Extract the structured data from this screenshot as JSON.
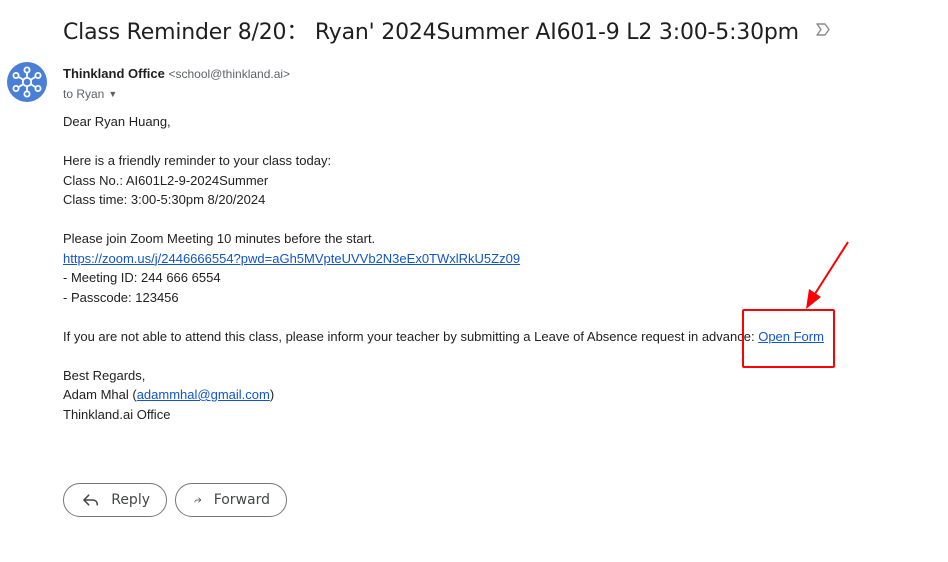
{
  "email": {
    "subject": "Class Reminder 8/20： Ryan' 2024Summer AI601-9 L2 3:00-5:30pm",
    "sender_name": "Thinkland Office",
    "sender_email": "<school@thinkland.ai>",
    "recipient": "to Ryan",
    "body": {
      "greeting": "Dear Ryan Huang,",
      "reminder": "Here is a friendly reminder to your class today:",
      "class_no": "Class No.: AI601L2-9-2024Summer",
      "class_time": "Class time: 3:00-5:30pm 8/20/2024",
      "join_note": "Please join Zoom Meeting 10 minutes before the start.",
      "zoom_link": "https://zoom.us/j/2446666554?pwd=aGh5MVpteUVVb2N3eEx0TWxlRkU5Zz09",
      "meeting_id": "- Meeting ID: 244 666 6554",
      "passcode": "- Passcode: 123456",
      "absence_text": "If you are not able to attend this class, please inform your teacher by submitting a Leave of Absence request in advance: ",
      "open_form": "Open Form",
      "regards": "Best Regards,",
      "signer_name": "Adam Mhal (",
      "signer_email": "adammhal@gmail.com",
      "signer_close": ")",
      "office": "Thinkland.ai Office"
    }
  },
  "actions": {
    "reply_label": "Reply",
    "forward_label": "Forward"
  },
  "colors": {
    "link": "#1155cc",
    "avatar": "#4a7fd8",
    "annotation": "#ff0000"
  },
  "icons": {
    "avatar": "network-hub-icon",
    "subject": "label-importance-icon",
    "recipient_dropdown": "caret-down-icon",
    "reply": "reply-arrow-icon",
    "forward": "forward-arrow-icon"
  }
}
